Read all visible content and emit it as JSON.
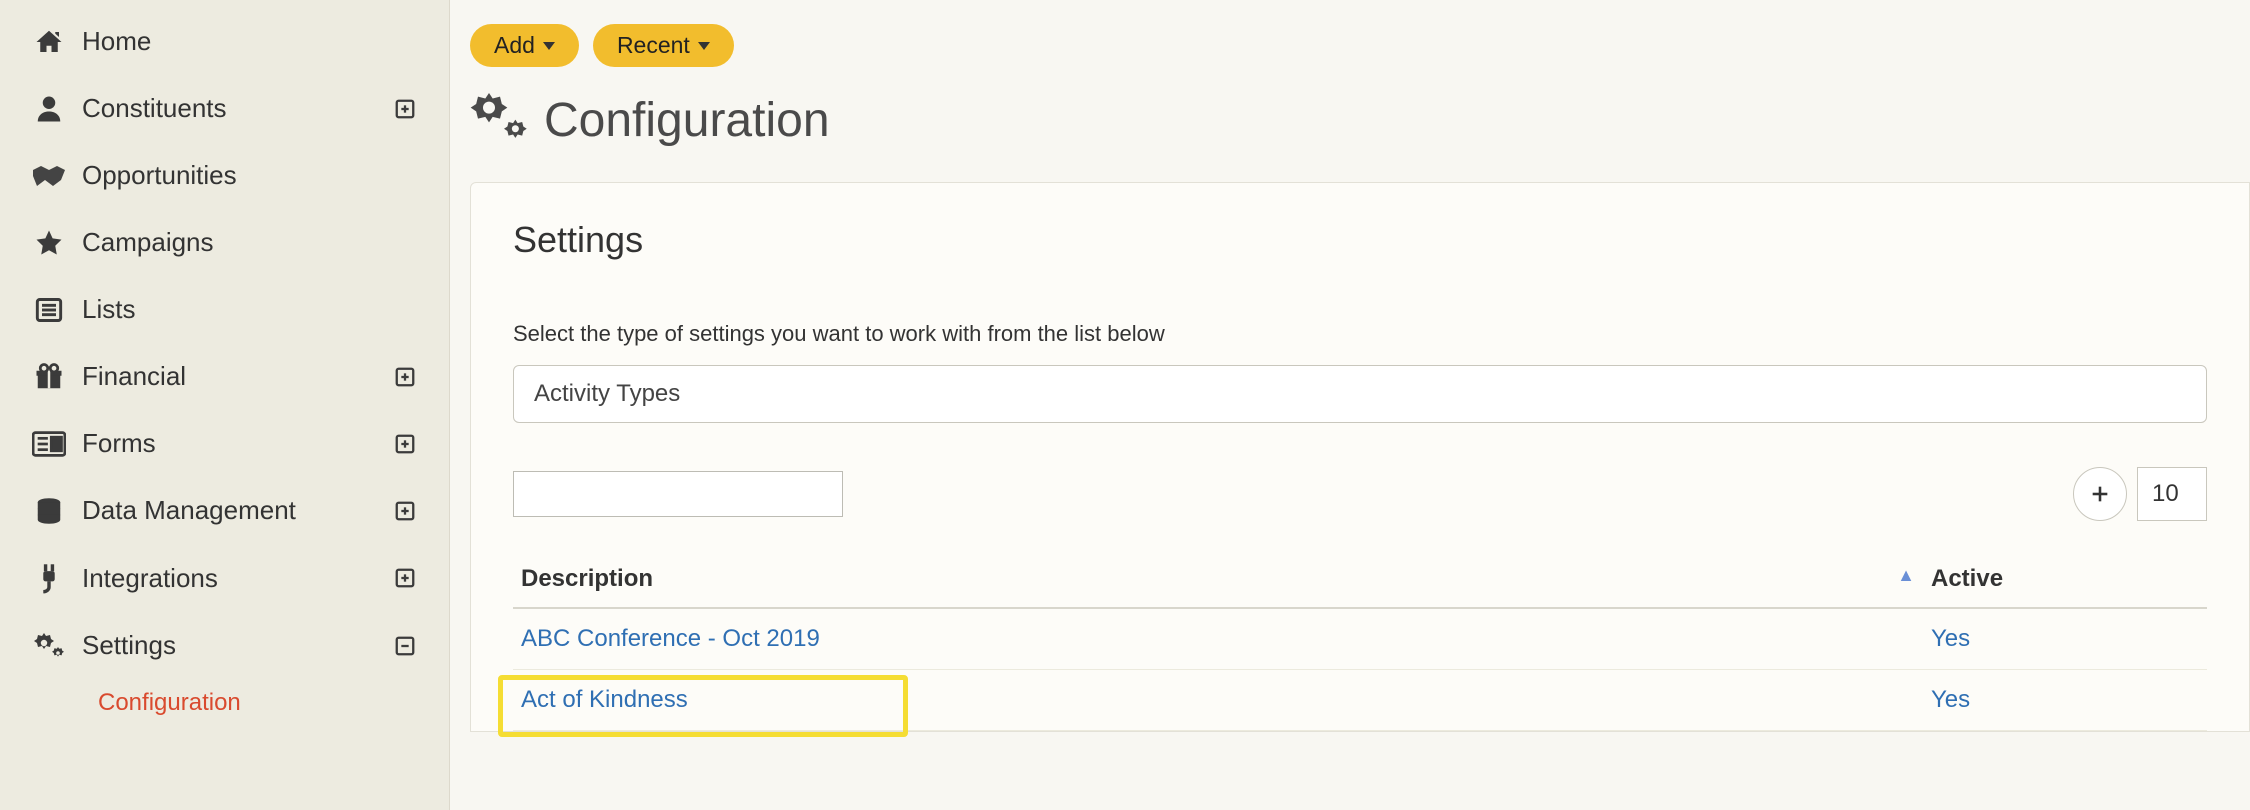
{
  "sidebar": {
    "items": [
      {
        "label": "Home",
        "expandable": false
      },
      {
        "label": "Constituents",
        "expandable": true
      },
      {
        "label": "Opportunities",
        "expandable": false
      },
      {
        "label": "Campaigns",
        "expandable": false
      },
      {
        "label": "Lists",
        "expandable": false
      },
      {
        "label": "Financial",
        "expandable": true
      },
      {
        "label": "Forms",
        "expandable": true
      },
      {
        "label": "Data Management",
        "expandable": true
      },
      {
        "label": "Integrations",
        "expandable": true
      },
      {
        "label": "Settings",
        "expandable": true,
        "active": true
      }
    ],
    "sub_item": "Configuration"
  },
  "topbar": {
    "add_label": "Add",
    "recent_label": "Recent"
  },
  "page": {
    "title": "Configuration",
    "panel_title": "Settings",
    "instruction": "Select the type of settings you want to work with from the list below",
    "selected_type": "Activity Types",
    "page_size": "10"
  },
  "table": {
    "columns": {
      "description": "Description",
      "active": "Active"
    },
    "rows": [
      {
        "description": "ABC Conference - Oct 2019",
        "active": "Yes"
      },
      {
        "description": "Act of Kindness",
        "active": "Yes"
      }
    ]
  }
}
